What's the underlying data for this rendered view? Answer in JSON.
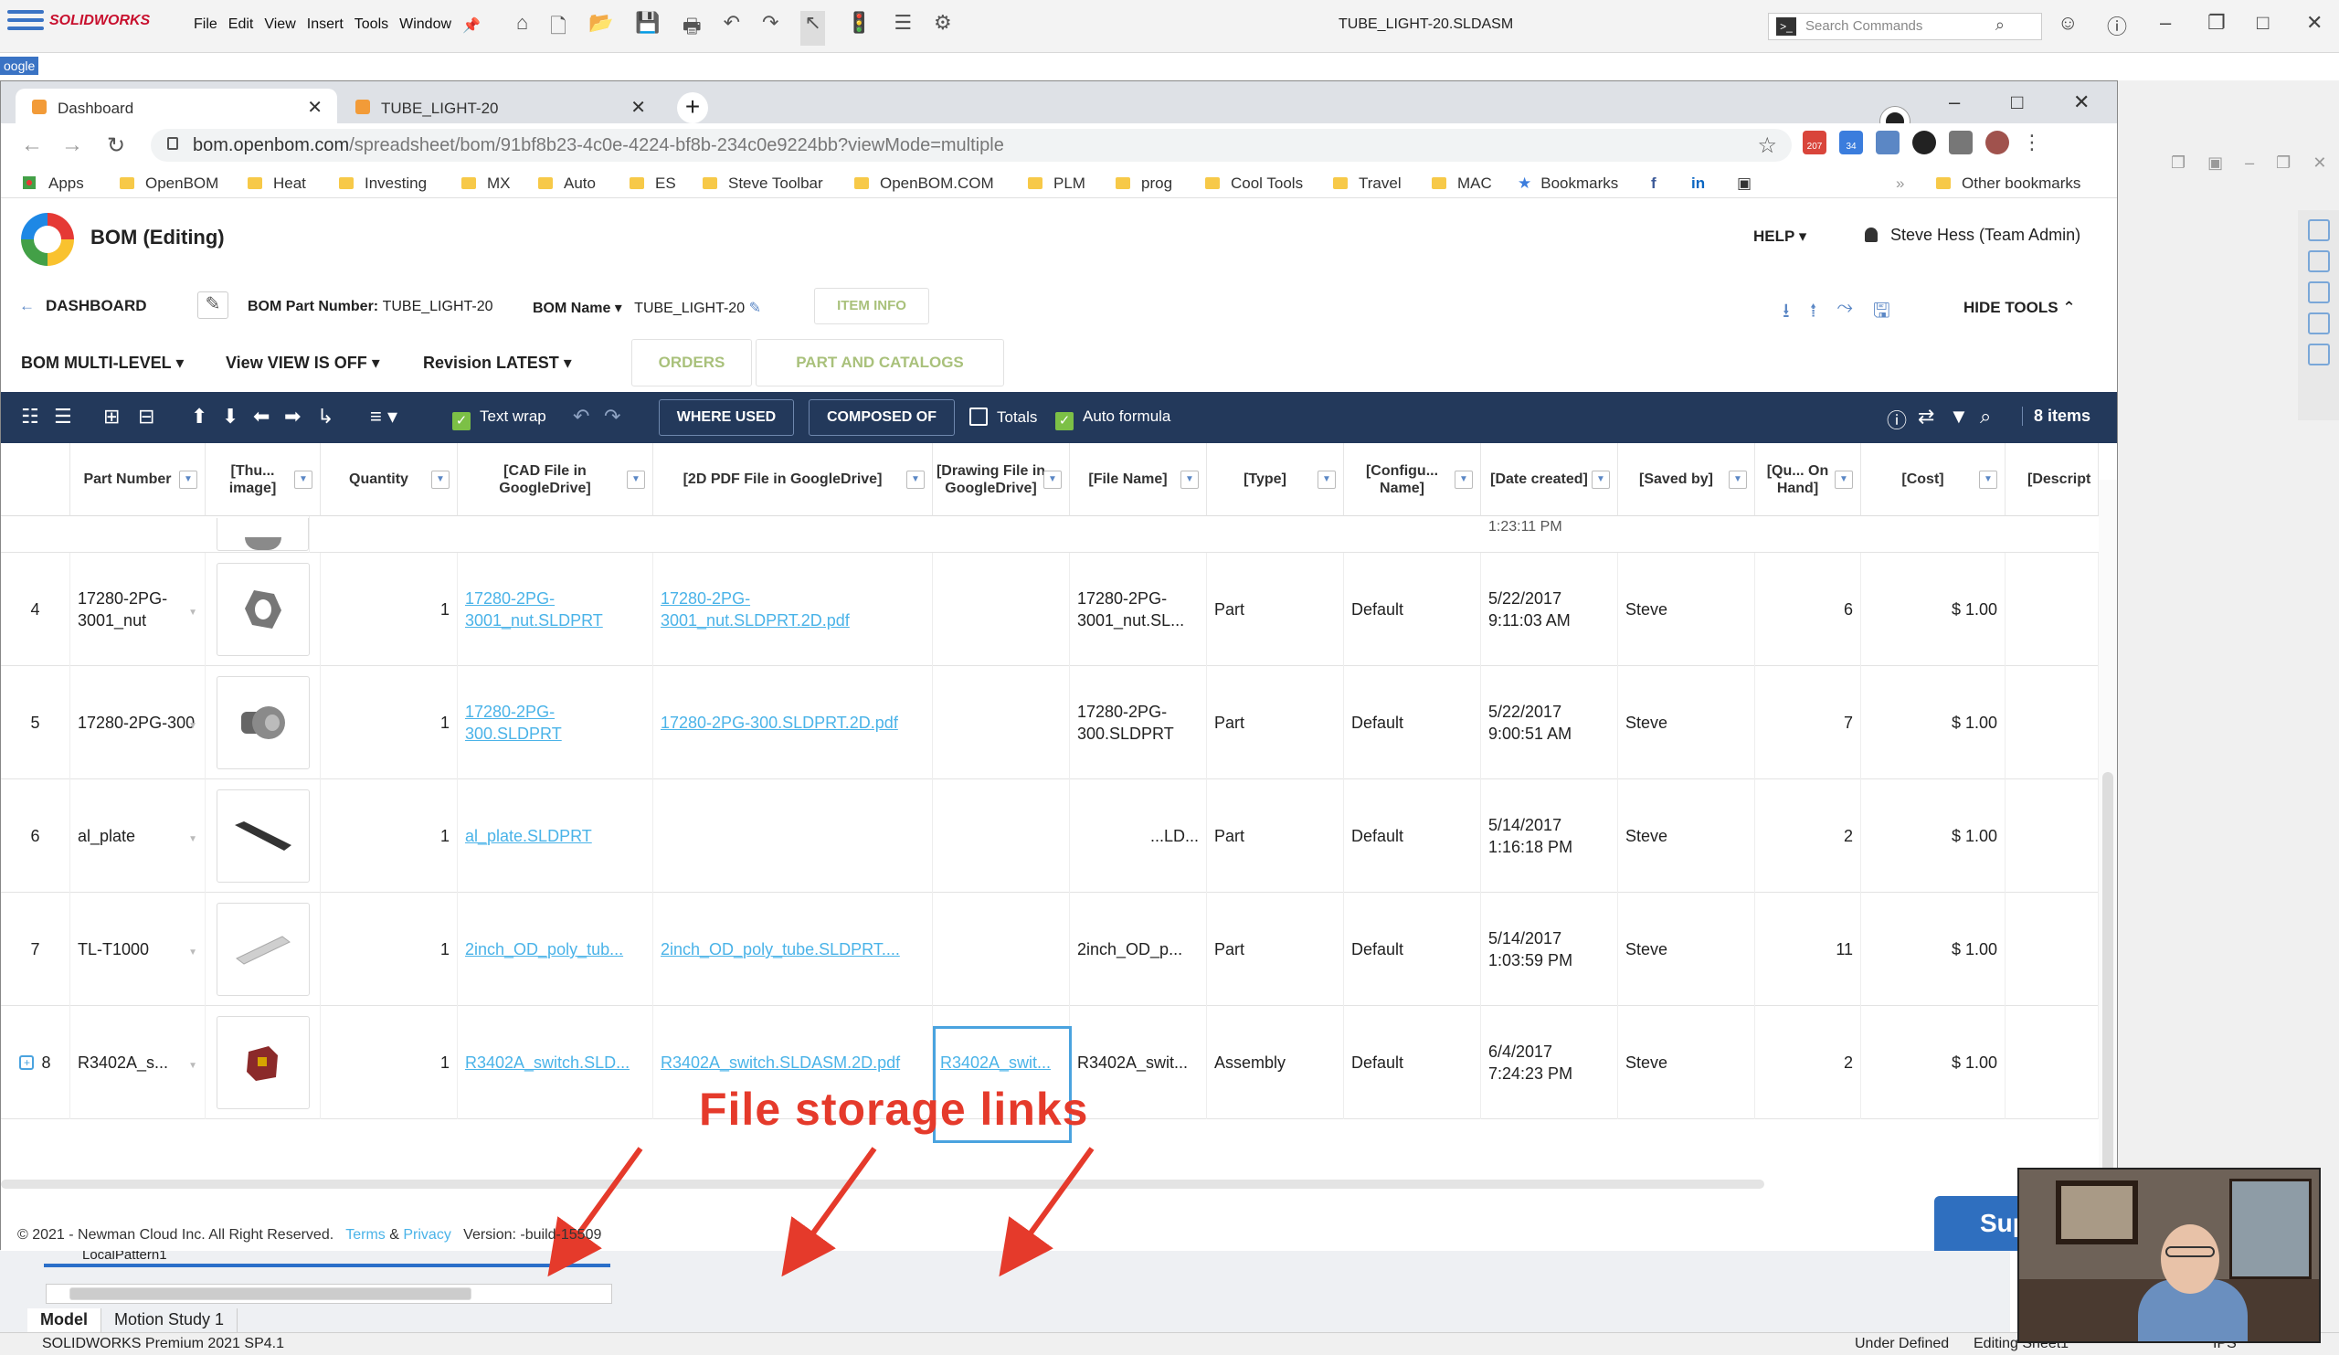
{
  "solidworks": {
    "logo": "SOLIDWORKS",
    "google_label": "oogle",
    "menu": [
      "File",
      "Edit",
      "View",
      "Insert",
      "Tools",
      "Window"
    ],
    "title": "TUBE_LIGHT-20.SLDASM",
    "search_placeholder": "Search Commands",
    "tree_item": "LocalPattern1",
    "tabs": [
      "Model",
      "Motion Study 1"
    ],
    "status_left": "SOLIDWORKS Premium 2021 SP4.1",
    "status_right": [
      "Under Defined",
      "Editing Sheet1",
      "IPS"
    ]
  },
  "browser": {
    "tabs": [
      {
        "label": "Dashboard",
        "active": true
      },
      {
        "label": "TUBE_LIGHT-20",
        "active": false
      }
    ],
    "url_host": "bom.openbom.com",
    "url_path": "/spreadsheet/bom/91bf8b23-4c0e-4224-bf8b-234c0e9224bb?viewMode=multiple",
    "ext_badges": [
      "207",
      "34"
    ],
    "bookmarks": [
      "Apps",
      "OpenBOM",
      "Heat",
      "Investing",
      "MX",
      "Auto",
      "ES",
      "Steve Toolbar",
      "OpenBOM.COM",
      "PLM",
      "prog",
      "Cool Tools",
      "Travel",
      "MAC",
      "Bookmarks"
    ],
    "other_bookmarks": "Other bookmarks"
  },
  "openbom": {
    "title": "BOM (Editing)",
    "help": "HELP",
    "user": "Steve Hess (Team Admin)",
    "dashboard": "DASHBOARD",
    "bom_part_number_label": "BOM Part Number:",
    "bom_part_number": "TUBE_LIGHT-20",
    "bom_name_label": "BOM Name",
    "bom_name": "TUBE_LIGHT-20",
    "item_info": "ITEM INFO",
    "hide_tools": "HIDE TOOLS",
    "bom_label": "BOM",
    "bom_value": "MULTI-LEVEL",
    "view_label": "View",
    "view_value": "VIEW IS OFF",
    "revision_label": "Revision",
    "revision_value": "LATEST",
    "orders": "ORDERS",
    "part_catalogs": "PART AND CATALOGS",
    "text_wrap": "Text wrap",
    "where_used": "WHERE USED",
    "composed_of": "COMPOSED OF",
    "totals": "Totals",
    "auto_formula": "Auto formula",
    "items_count": "8 items",
    "columns": [
      "Part Number",
      "[Thu... image]",
      "Quantity",
      "[CAD File in GoogleDrive]",
      "[2D PDF File in GoogleDrive]",
      "[Drawing File in GoogleDrive]",
      "[File Name]",
      "[Type]",
      "[Configu... Name]",
      "[Date created]",
      "[Saved by]",
      "[Qu... On Hand]",
      "[Cost]",
      "[Descript"
    ],
    "partial_row_date": "1:23:11 PM",
    "rows": [
      {
        "n": "4",
        "part": "17280-2PG-3001_nut",
        "qty": "1",
        "cad": "17280-2PG-3001_nut.SLDPRT",
        "pdf": "17280-2PG-3001_nut.SLDPRT.2D.pdf",
        "drw": "",
        "file": "17280-2PG-3001_nut.SL...",
        "type": "Part",
        "config": "Default",
        "date": "5/22/2017 9:11:03 AM",
        "saved": "Steve",
        "onhand": "6",
        "cost": "$ 1.00"
      },
      {
        "n": "5",
        "part": "17280-2PG-300",
        "qty": "1",
        "cad": "17280-2PG-300.SLDPRT",
        "pdf": "17280-2PG-300.SLDPRT.2D.pdf",
        "drw": "",
        "file": "17280-2PG-300.SLDPRT",
        "type": "Part",
        "config": "Default",
        "date": "5/22/2017 9:00:51 AM",
        "saved": "Steve",
        "onhand": "7",
        "cost": "$ 1.00"
      },
      {
        "n": "6",
        "part": "al_plate",
        "qty": "1",
        "cad": "al_plate.SLDPRT",
        "pdf": "",
        "drw": "",
        "file": "...LD...",
        "type": "Part",
        "config": "Default",
        "date": "5/14/2017 1:16:18 PM",
        "saved": "Steve",
        "onhand": "2",
        "cost": "$ 1.00"
      },
      {
        "n": "7",
        "part": "TL-T1000",
        "qty": "1",
        "cad": "2inch_OD_poly_tub...",
        "pdf": "2inch_OD_poly_tube.SLDPRT....",
        "drw": "",
        "file": "2inch_OD_p...",
        "type": "Part",
        "config": "Default",
        "date": "5/14/2017 1:03:59 PM",
        "saved": "Steve",
        "onhand": "11",
        "cost": "$ 1.00"
      },
      {
        "n": "8",
        "part": "R3402A_s...",
        "qty": "1",
        "cad": "R3402A_switch.SLD...",
        "pdf": "R3402A_switch.SLDASM.2D.pdf",
        "drw": "R3402A_swit...",
        "file": "R3402A_swit...",
        "type": "Assembly",
        "config": "Default",
        "date": "6/4/2017 7:24:23 PM",
        "saved": "Steve",
        "onhand": "2",
        "cost": "$ 1.00"
      }
    ],
    "footer_copy": "© 2021 - Newman Cloud Inc. All Right Reserved.",
    "footer_terms": "Terms",
    "footer_amp": "&",
    "footer_privacy": "Privacy",
    "footer_version": "Version: -build-15509",
    "support": "Supp"
  },
  "annotation": "File storage links",
  "colors": {
    "toolbar": "#23395b",
    "link": "#4ab3e8",
    "annotation": "#e53a2b",
    "accent_green": "#a9c17b"
  }
}
